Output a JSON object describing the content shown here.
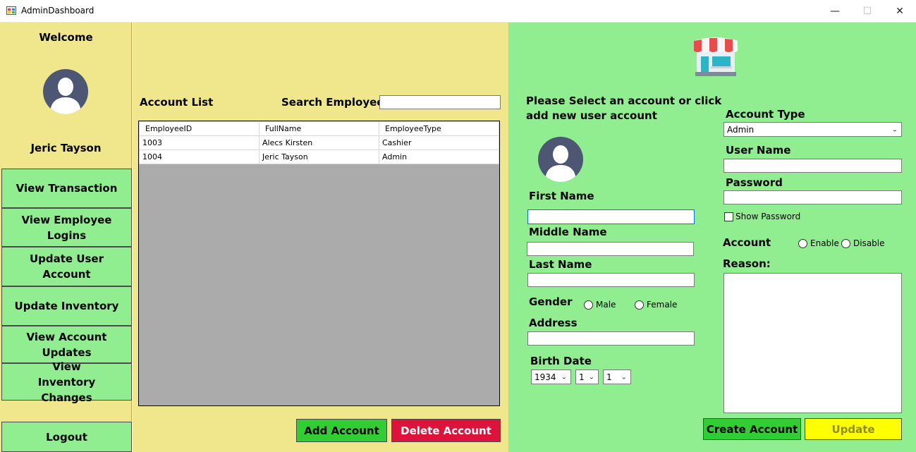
{
  "window": {
    "title": "AdminDashboard",
    "minimize": "—",
    "maximize": "☐",
    "close": "✕"
  },
  "sidebar": {
    "welcome": "Welcome",
    "user_name": "Jeric Tayson",
    "nav": {
      "view_transaction": "View Transaction",
      "view_employee_logins": "View Employee Logins",
      "update_user_account": "Update User Account",
      "update_inventory": "Update Inventory",
      "view_account_updates": "View Account Updates",
      "view_inventory_changes": "View Inventory Changes"
    },
    "logout": "Logout"
  },
  "accounts": {
    "list_label": "Account List",
    "search_label": "Search Employee",
    "search_value": "",
    "columns": [
      "EmployeeID",
      "FullName",
      "EmployeeType"
    ],
    "rows": [
      [
        "1003",
        "Alecs Kirsten",
        "Cashier"
      ],
      [
        "1004",
        "Jeric Tayson",
        "Admin"
      ]
    ],
    "add_button": "Add Account",
    "delete_button": "Delete Account"
  },
  "form": {
    "instruction": "Please Select an account or click add new user account",
    "first_name_label": "First Name",
    "first_name_value": "",
    "middle_name_label": "Middle Name",
    "middle_name_value": "",
    "last_name_label": "Last Name",
    "last_name_value": "",
    "gender_label": "Gender",
    "gender_male": "Male",
    "gender_female": "Female",
    "address_label": "Address",
    "address_value": "",
    "birth_date_label": "Birth Date",
    "birth_year": "1934",
    "birth_month": "1",
    "birth_day": "1",
    "account_type_label": "Account Type",
    "account_type_value": "Admin",
    "user_name_label": "User Name",
    "user_name_value": "",
    "password_label": "Password",
    "password_value": "",
    "show_password": "Show Password",
    "account_label": "Account",
    "account_enable": "Enable",
    "account_disable": "Disable",
    "reason_label": "Reason:",
    "reason_value": "",
    "create_button": "Create Account",
    "update_button": "Update"
  },
  "colors": {
    "khaki": "#f0e68c",
    "light_green": "#90ee90",
    "add_green": "#32cd32",
    "delete_red": "#dc143c",
    "create_green": "#32cd32",
    "update_yellow": "#ffff00",
    "avatar_bg": "#4d5773"
  }
}
